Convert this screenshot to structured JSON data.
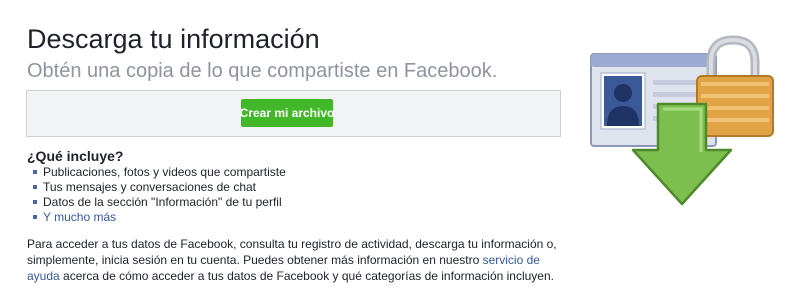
{
  "header": {
    "title": "Descarga tu información",
    "subtitle": "Obtén una copia de lo que compartiste en Facebook."
  },
  "action": {
    "create_label": "Crear mi archivo"
  },
  "includes": {
    "heading": "¿Qué incluye?",
    "items": [
      "Publicaciones, fotos y videos que compartiste",
      "Tus mensajes y conversaciones de chat",
      "Datos de la sección \"Información\" de tu perfil"
    ],
    "more_link": "Y mucho más"
  },
  "info": {
    "text_before": "Para acceder a tus datos de Facebook, consulta tu registro de actividad, descarga tu información o, simplemente, inicia sesión en tu cuenta. Puedes obtener más información en nuestro ",
    "help_link": "servicio de ayuda",
    "text_after": " acerca de cómo acceder a tus datos de Facebook y qué categorías de información incluyen."
  },
  "illustration": {
    "icon": "download-archive-icon",
    "colors": {
      "arrow": "#7cbf4e",
      "lock": "#e0a445",
      "card": "#e9ecf3",
      "card_header": "#9aaad0",
      "avatar": "#3b5998"
    }
  }
}
